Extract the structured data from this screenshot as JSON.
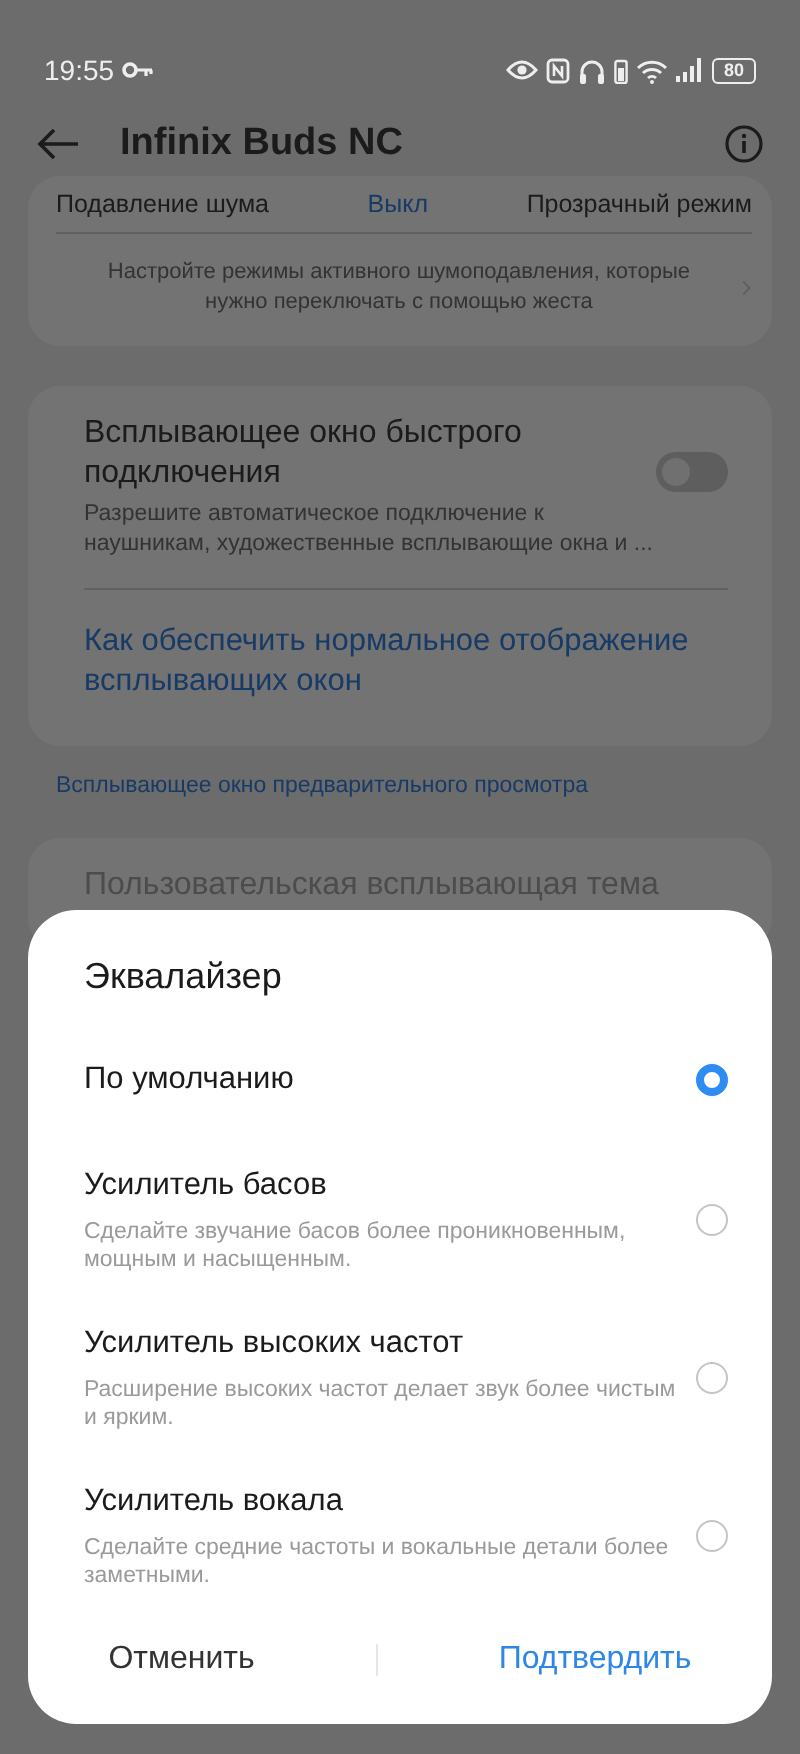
{
  "status_bar": {
    "time": "19:55",
    "battery": "80"
  },
  "header": {
    "title": "Infinix Buds NC"
  },
  "noise_modes": {
    "labels": [
      "Подавление шума",
      "Выкл",
      "Прозрачный режим"
    ],
    "hint": "Настройте режимы активного шумоподавления, которые нужно переключать с помощью жеста"
  },
  "popup_card": {
    "title": "Всплывающее окно быстрого подключения",
    "description": "Разрешите автоматическое подключение к наушникам, художественные всплывающие окна и ...",
    "on": false,
    "link": "Как обеспечить нормальное отображение всплывающих окон"
  },
  "preview_link": "Всплывающее окно предварительного просмотра",
  "theme_row": {
    "title": "Пользовательская всплывающая тема"
  },
  "dialog": {
    "title": "Эквалайзер",
    "options": [
      {
        "label": "По умолчанию",
        "selected": true
      },
      {
        "label": "Усилитель басов",
        "description": "Сделайте звучание басов более проникновенным, мощным и насыщенным.",
        "selected": false
      },
      {
        "label": "Усилитель высоких частот",
        "description": "Расширение высоких частот делает звук более чистым и ярким.",
        "selected": false
      },
      {
        "label": "Усилитель вокала",
        "description": "Сделайте средние частоты и вокальные детали более заметными.",
        "selected": false
      }
    ],
    "buttons": [
      {
        "label": "Отменить",
        "kind": "cancel"
      },
      {
        "label": "Подтвердить",
        "kind": "confirm"
      }
    ]
  }
}
